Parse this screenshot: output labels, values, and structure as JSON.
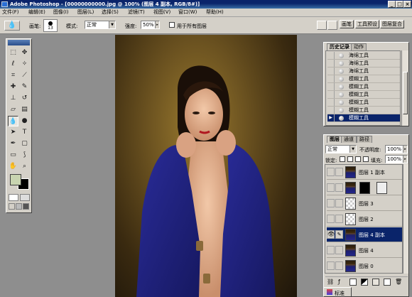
{
  "window": {
    "title": "Adobe Photoshop - [00000000000.jpg @ 100% (图层 4 副本, RGB/8#)]",
    "minimize": "_",
    "maximize": "□",
    "close": "×"
  },
  "menu": {
    "items": [
      "文件(F)",
      "编辑(E)",
      "图像(I)",
      "图层(L)",
      "选择(S)",
      "滤镜(T)",
      "视图(V)",
      "窗口(W)",
      "帮助(H)"
    ]
  },
  "options": {
    "brush_label": "画笔:",
    "brush_size": "13",
    "mode_label": "模式:",
    "mode_value": "正常",
    "strength_label": "强度:",
    "strength_value": "50%",
    "all_layers_label": "用于所有图层",
    "all_layers_checked": false
  },
  "palette_well": {
    "tabs": [
      "画笔",
      "工具预设",
      "图层复合"
    ]
  },
  "toolbox": {
    "tools": [
      "marquee",
      "move",
      "lasso",
      "magic-wand",
      "crop",
      "slice",
      "healing",
      "brush",
      "clone-stamp",
      "history-brush",
      "eraser",
      "gradient",
      "blur",
      "dodge",
      "path-select",
      "type",
      "pen",
      "shape",
      "notes",
      "eyedropper",
      "hand",
      "zoom"
    ],
    "active_tool": "blur",
    "foreground_color": "#c8d4b0",
    "background_color": "#000000"
  },
  "history": {
    "tabs": [
      "历史记录",
      "动作"
    ],
    "items": [
      {
        "label": "海绵工具",
        "icon": "sponge-icon"
      },
      {
        "label": "海绵工具",
        "icon": "sponge-icon"
      },
      {
        "label": "海绵工具",
        "icon": "sponge-icon"
      },
      {
        "label": "模糊工具",
        "icon": "blur-drop-icon"
      },
      {
        "label": "模糊工具",
        "icon": "blur-drop-icon"
      },
      {
        "label": "模糊工具",
        "icon": "blur-drop-icon"
      },
      {
        "label": "模糊工具",
        "icon": "blur-drop-icon"
      },
      {
        "label": "模糊工具",
        "icon": "blur-drop-icon"
      },
      {
        "label": "模糊工具",
        "icon": "blur-drop-icon",
        "selected": true
      }
    ]
  },
  "layers": {
    "tabs": [
      "图层",
      "通道",
      "路径"
    ],
    "blend_mode": "正常",
    "opacity_label": "不透明度:",
    "opacity_value": "100%",
    "lock_label": "锁定:",
    "fill_label": "填充:",
    "fill_value": "100%",
    "items": [
      {
        "label": "图层 1 副本",
        "thumb": "photo"
      },
      {
        "label": "",
        "thumb": "black",
        "has_mask": true
      },
      {
        "label": "图层 3",
        "thumb": "checker"
      },
      {
        "label": "图层 2",
        "thumb": "checker"
      },
      {
        "label": "图层 4 副本",
        "thumb": "photo",
        "selected": true
      },
      {
        "label": "图层 4",
        "thumb": "photo"
      },
      {
        "label": "图层 0",
        "thumb": "photo"
      }
    ]
  },
  "status": {
    "label": "标准"
  }
}
